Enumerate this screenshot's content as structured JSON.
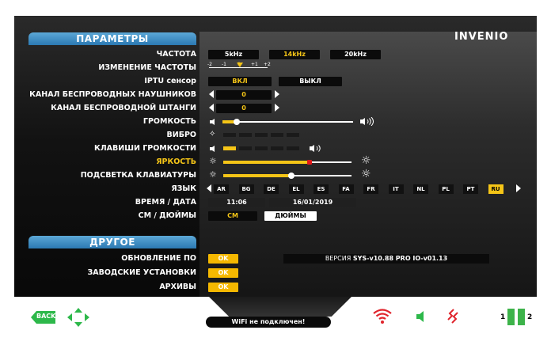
{
  "logo": {
    "text": "INVENIO"
  },
  "sections": {
    "params": "ПАРАМЕТРЫ",
    "other": "ДРУГОЕ"
  },
  "rows": {
    "frequency": {
      "label": "ЧАСТОТА",
      "options": [
        "5kHz",
        "14kHz",
        "20kHz"
      ],
      "selected": "14kHz"
    },
    "freq_shift": {
      "label": "ИЗМЕНЕНИЕ ЧАСТОТЫ",
      "ticks": [
        "-2",
        "-1",
        "0",
        "+1",
        "+2"
      ],
      "value": "0"
    },
    "iptu": {
      "label": "IPTU сенсор",
      "on": "ВКЛ",
      "off": "ВЫКЛ",
      "selected": "ВКЛ"
    },
    "headphones_channel": {
      "label": "КАНАЛ БЕСПРОВОДНЫХ НАУШНИКОВ",
      "value": "0"
    },
    "coil_channel": {
      "label": "КАНАЛ БЕСПРОВОДНОЙ ШТАНГИ",
      "value": "0"
    },
    "volume": {
      "label": "ГРОМКОСТЬ",
      "level": 0.11
    },
    "vibro": {
      "label": "ВИБРО",
      "level": 0
    },
    "volume_keys": {
      "label": "КЛАВИШИ ГРОМКОСТИ",
      "level": 1,
      "max": 6
    },
    "brightness": {
      "label": "ЯРКОСТЬ",
      "level": 0.68
    },
    "keypad_light": {
      "label": "ПОДСВЕТКА КЛАВИАТУРЫ",
      "level": 0.53
    },
    "language": {
      "label": "ЯЗЫК",
      "options": [
        "AR",
        "BG",
        "DE",
        "EL",
        "ES",
        "FA",
        "FR",
        "IT",
        "NL",
        "PL",
        "PT",
        "RU"
      ],
      "selected": "RU"
    },
    "datetime": {
      "label": "ВРЕМЯ / ДАТА",
      "time": "11:06",
      "date": "16/01/2019"
    },
    "units": {
      "label": "СМ / ДЮЙМЫ",
      "cm": "СМ",
      "inches": "ДЮЙМЫ",
      "selected": "СМ"
    },
    "update": {
      "label": "ОБНОВЛЕНИЕ ПО",
      "button": "OK",
      "version_prefix": "ВЕРСИЯ",
      "version": "SYS-v10.88 PRO  IO-v01.13"
    },
    "factory": {
      "label": "ЗАВОДСКИЕ УСТАНОВКИ",
      "button": "OK"
    },
    "archives": {
      "label": "АРХИВЫ",
      "button": "OK"
    }
  },
  "footer": {
    "back": "BACK",
    "wifi_status": "WiFi не подключен!",
    "battery_1": "1",
    "battery_2": "2"
  },
  "colors": {
    "accent": "#f5c517",
    "section": "#2b79b2",
    "wifi": "#e0242c",
    "speaker": "#2db84a",
    "battery": "#3db34a"
  }
}
